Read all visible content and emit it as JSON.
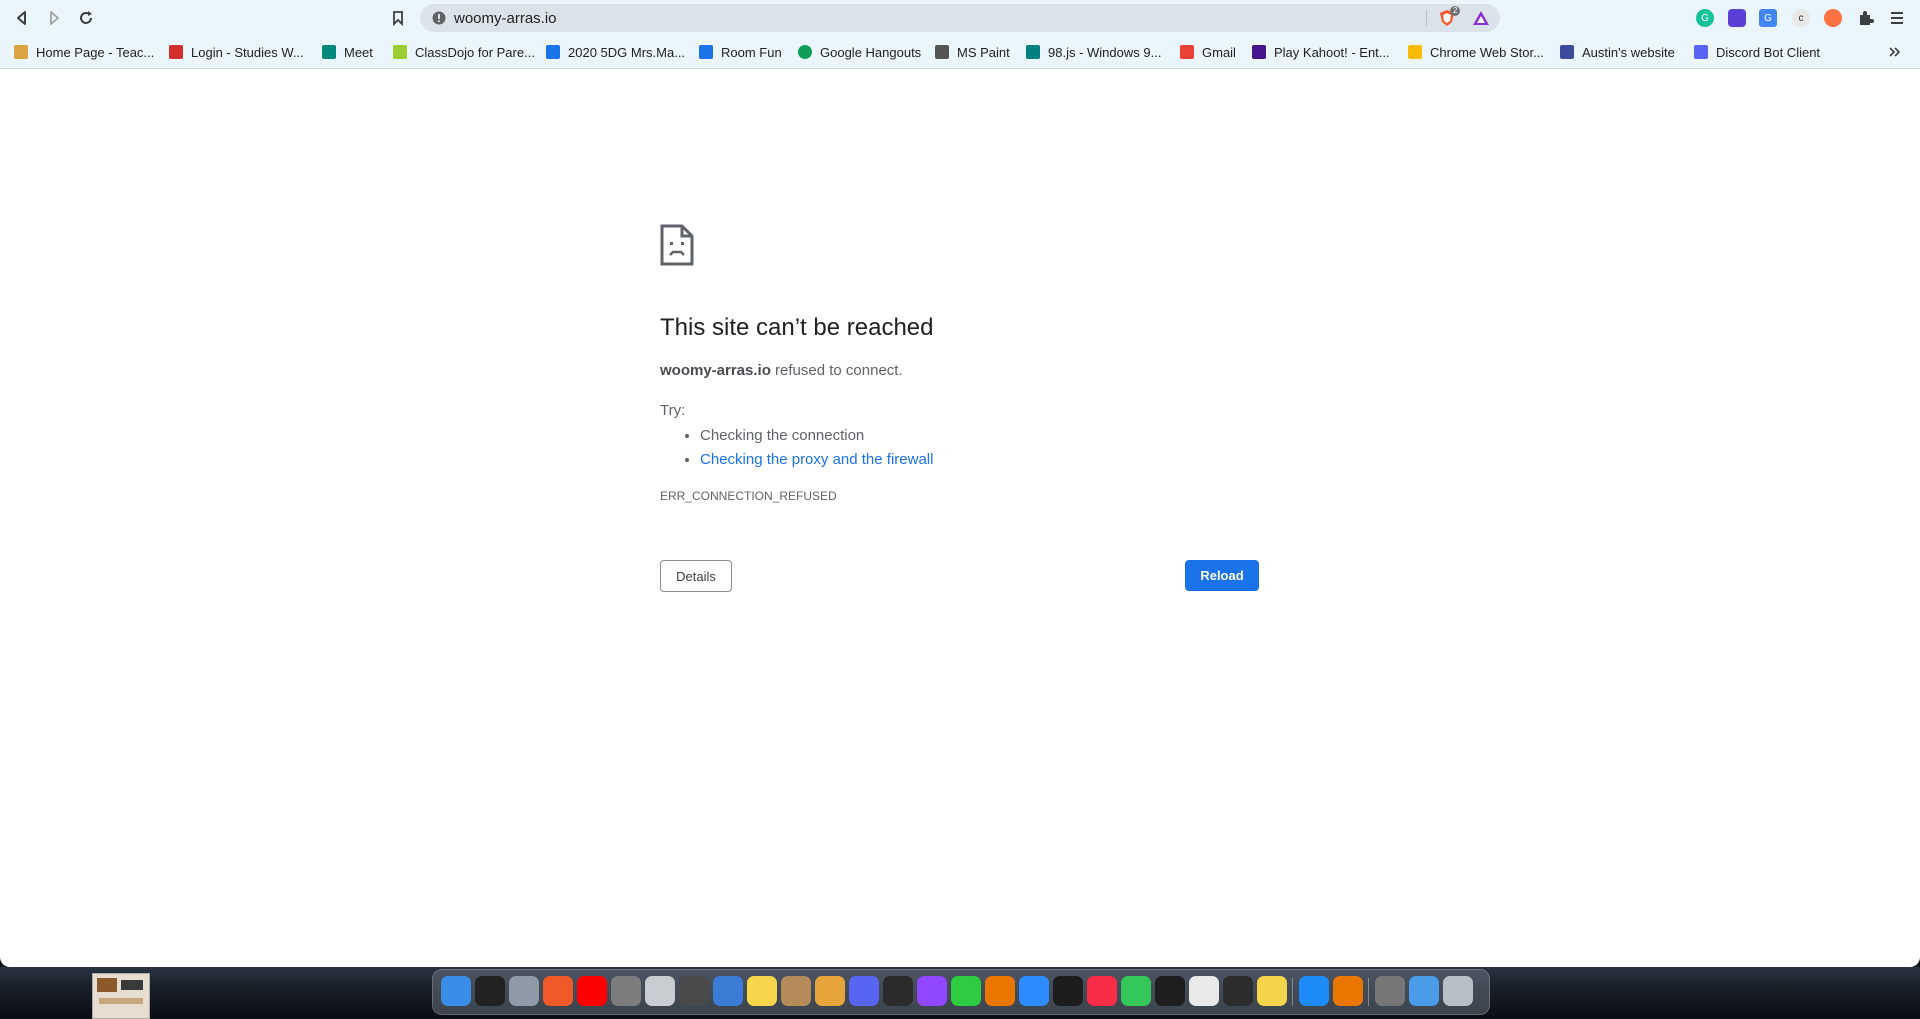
{
  "browser": {
    "url": "woomy-arras.io",
    "shield_badge": "2"
  },
  "bookmarks": [
    {
      "label": "Home Page - Teac...",
      "icon": "teacher-icon",
      "color": "#d9a441"
    },
    {
      "label": "Login - Studies W...",
      "icon": "apple-icon",
      "color": "#d62d2d"
    },
    {
      "label": "Meet",
      "icon": "meet-icon",
      "color": "#00897b"
    },
    {
      "label": "ClassDojo for Pare...",
      "icon": "classdojo-icon",
      "color": "#9acd32"
    },
    {
      "label": "2020 5DG Mrs.Ma...",
      "icon": "classroom-icon",
      "color": "#1a73e8"
    },
    {
      "label": "Room Fun",
      "icon": "classroom-icon",
      "color": "#1a73e8"
    },
    {
      "label": "Google Hangouts",
      "icon": "hangouts-icon",
      "color": "#0f9d58"
    },
    {
      "label": "MS Paint",
      "icon": "paint-icon",
      "color": "#555555"
    },
    {
      "label": "98.js - Windows 9...",
      "icon": "windows98-icon",
      "color": "#008080"
    },
    {
      "label": "Gmail",
      "icon": "gmail-icon",
      "color": "#ea4335"
    },
    {
      "label": "Play Kahoot! - Ent...",
      "icon": "kahoot-icon",
      "color": "#46178f"
    },
    {
      "label": "Chrome Web Stor...",
      "icon": "webstore-icon",
      "color": "#fbbc05"
    },
    {
      "label": "Austin's website",
      "icon": "site-icon",
      "color": "#3c4a9c"
    },
    {
      "label": "Discord Bot Client",
      "icon": "discord-icon",
      "color": "#5865f2"
    }
  ],
  "error": {
    "title": "This site can’t be reached",
    "host": "woomy-arras.io",
    "message": " refused to connect.",
    "try_label": "Try:",
    "suggestion_1": "Checking the connection",
    "suggestion_2": "Checking the proxy and the firewall",
    "code": "ERR_CONNECTION_REFUSED",
    "details_label": "Details",
    "reload_label": "Reload"
  },
  "dock": {
    "apps": [
      {
        "name": "finder-icon",
        "color": "#3b8ee8"
      },
      {
        "name": "widgets-icon",
        "color": "#222222"
      },
      {
        "name": "launchpad-icon",
        "color": "#8e9aa8"
      },
      {
        "name": "brave-icon",
        "color": "#f05a28"
      },
      {
        "name": "youtube-icon",
        "color": "#ff0000"
      },
      {
        "name": "system-preferences-icon",
        "color": "#7d7d7d"
      },
      {
        "name": "roblox-icon",
        "color": "#c9ccd1"
      },
      {
        "name": "file-manager-icon",
        "color": "#4a4a4a"
      },
      {
        "name": "preview-icon",
        "color": "#3a7bd5"
      },
      {
        "name": "notes-icon",
        "color": "#f6d64a"
      },
      {
        "name": "contacts-icon",
        "color": "#b58b5a"
      },
      {
        "name": "cyberduck-icon",
        "color": "#e7a43a"
      },
      {
        "name": "discord-dock-icon",
        "color": "#5865f2"
      },
      {
        "name": "obs-icon",
        "color": "#2b2b2b"
      },
      {
        "name": "twitch-icon",
        "color": "#9146ff"
      },
      {
        "name": "facetime-icon",
        "color": "#2ecc40"
      },
      {
        "name": "blender-icon",
        "color": "#ea7600"
      },
      {
        "name": "zoom-icon",
        "color": "#2d8cff"
      },
      {
        "name": "activity-monitor-icon",
        "color": "#1d1d1d"
      },
      {
        "name": "music-icon",
        "color": "#fa2d48"
      },
      {
        "name": "messages-icon",
        "color": "#34c759"
      },
      {
        "name": "terminal-icon",
        "color": "#1e1e1e"
      },
      {
        "name": "textedit-icon",
        "color": "#e9e9e9"
      },
      {
        "name": "console-icon",
        "color": "#2c2c2c"
      },
      {
        "name": "python-launcher-icon",
        "color": "#f3d44a"
      },
      {
        "name": "app-store-icon",
        "color": "#1d8cf8"
      },
      {
        "name": "blender-2-icon",
        "color": "#ea7600"
      },
      {
        "name": "coffee-icon",
        "color": "#777777"
      },
      {
        "name": "downloads-folder-icon",
        "color": "#4a9be8"
      },
      {
        "name": "trash-icon",
        "color": "#b8bfc6"
      }
    ]
  }
}
